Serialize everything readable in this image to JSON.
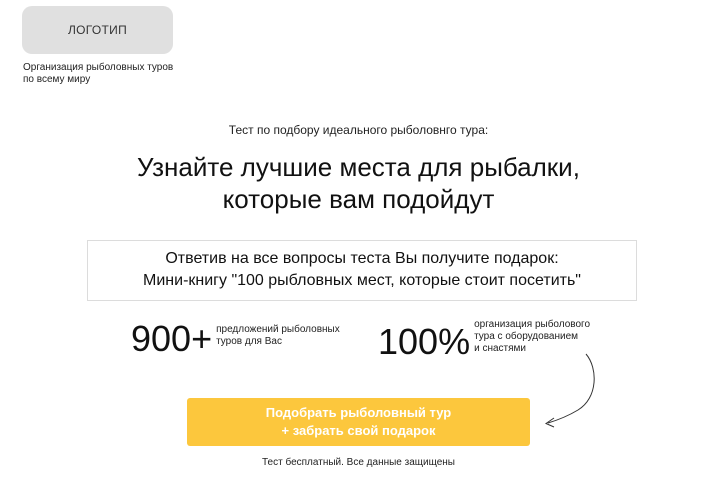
{
  "header": {
    "logo_label": "ЛОГОТИП",
    "tagline_line1": "Организация рыболовных туров",
    "tagline_line2": "по всему миру"
  },
  "hero": {
    "pre_title": "Тест по подбору идеального рыболовнго тура:",
    "title_line1": "Узнайте лучшие места для рыбалки,",
    "title_line2": "которые вам подойдут"
  },
  "gift": {
    "line1": "Ответив на все вопросы теста Вы получите подарок:",
    "line2": "Мини-книгу \"100 рыбловных мест, которые стоит посетить\""
  },
  "stats": [
    {
      "number": "900+",
      "desc_line1": "предложений рыболовных",
      "desc_line2": "туров для Вас"
    },
    {
      "number": "100%",
      "desc_line1": "организация рыболового",
      "desc_line2": "тура с оборудованием",
      "desc_line3": "и снастями"
    }
  ],
  "cta": {
    "line1": "Подобрать рыболовный тур",
    "line2": "+ забрать свой подарок",
    "color": "#fcc73d"
  },
  "footer": {
    "disclaimer": "Тест бесплатный. Все данные защищены"
  },
  "icons": {
    "arrow": "curved-arrow-icon"
  }
}
